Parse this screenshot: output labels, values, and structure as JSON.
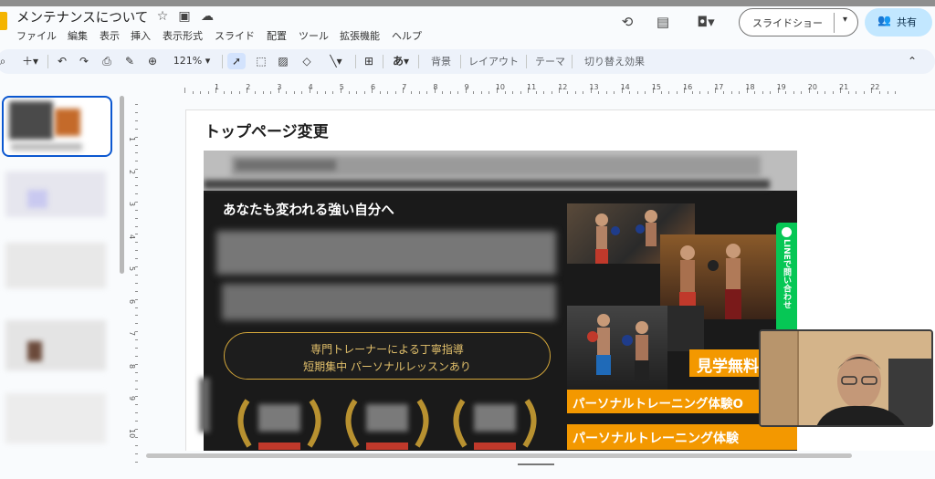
{
  "app": {
    "doc_title": "メンテナンスについて"
  },
  "menu": [
    "ファイル",
    "編集",
    "表示",
    "挿入",
    "表示形式",
    "スライド",
    "配置",
    "ツール",
    "拡張機能",
    "ヘルプ"
  ],
  "header": {
    "slideshow_label": "スライドショー",
    "share_label": "共有"
  },
  "toolbar": {
    "zoom": "121%",
    "text_input_glyph": "あ",
    "background": "背景",
    "layout": "レイアウト",
    "theme": "テーマ",
    "transition": "切り替え効果"
  },
  "ruler": {
    "h": [
      "1",
      "2",
      "3",
      "4",
      "5",
      "6",
      "7",
      "8",
      "9",
      "10",
      "11",
      "12",
      "13",
      "14",
      "15",
      "16",
      "17",
      "18",
      "19",
      "20",
      "21",
      "22"
    ],
    "v": [
      "1",
      "2",
      "3",
      "4",
      "5",
      "6",
      "7",
      "8",
      "9",
      "10"
    ]
  },
  "slide": {
    "title": "トップページ変更",
    "hero_text": "あなたも変われる強い自分へ",
    "pill_line1": "専門トレーナーによる丁寧指導",
    "pill_line2": "短期集中 パーソナルレッスンあり",
    "badge_free": "見学無料",
    "banner1": "パーソナルトレーニング体験O",
    "banner2": "パーソナルトレーニング体験",
    "line_tab": "LINEで問い合わせ"
  },
  "colors": {
    "accent": "#0b57d0",
    "share_bg": "#c2e7ff",
    "orange": "#f39800",
    "line_green": "#06c755",
    "gold": "#d4a73a"
  }
}
